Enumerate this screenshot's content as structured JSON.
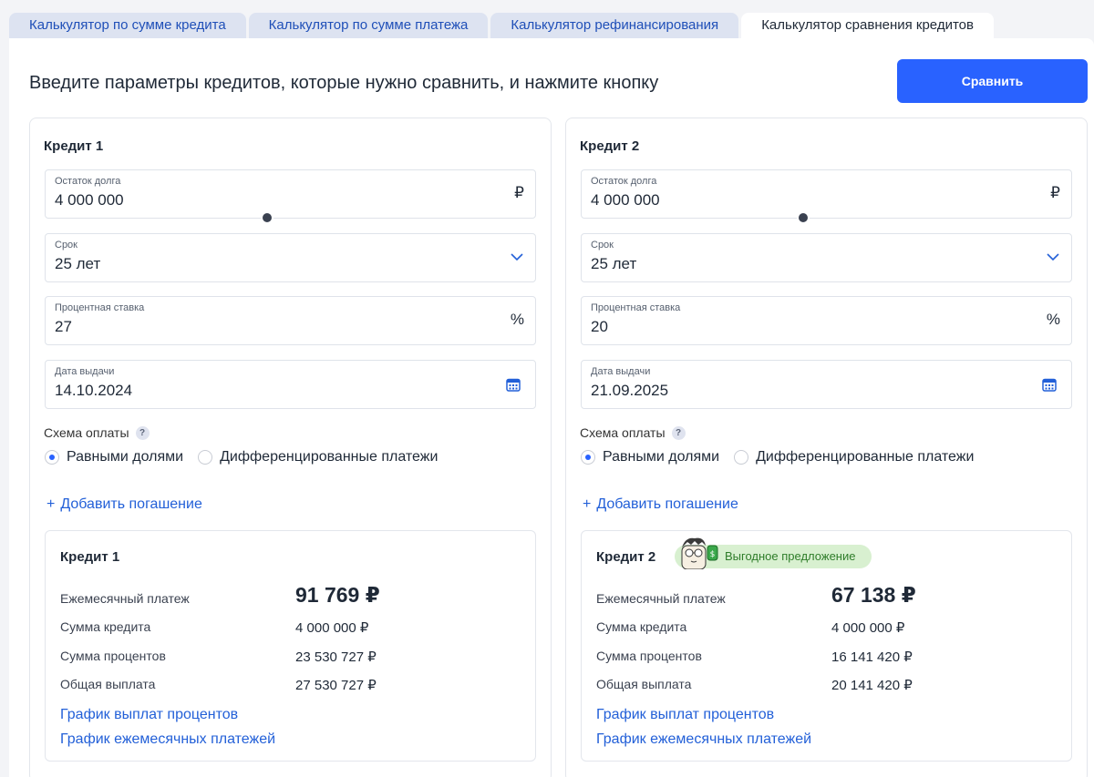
{
  "tabs": [
    {
      "label": "Калькулятор по сумме кредита"
    },
    {
      "label": "Калькулятор по сумме платежа"
    },
    {
      "label": "Калькулятор рефинансирования"
    },
    {
      "label": "Калькулятор сравнения кредитов"
    }
  ],
  "heading": "Введите параметры кредитов, которые нужно сравнить, и нажмите кнопку",
  "compare_button": "Сравнить",
  "credits": [
    {
      "title": "Кредит 1",
      "debt_label": "Остаток долга",
      "debt_value": "4 000 000",
      "debt_suffix": "₽",
      "term_label": "Срок",
      "term_value": "25 лет",
      "rate_label": "Процентная ставка",
      "rate_value": "27",
      "rate_suffix": "%",
      "date_label": "Дата выдачи",
      "date_value": "14.10.2024",
      "scheme_label": "Схема оплаты",
      "help": "?",
      "option_equal": "Равными долями",
      "option_diff": "Дифференцированные платежи",
      "add_repayment": "Добавить погашение",
      "plus": "+",
      "result": {
        "title": "Кредит 1",
        "monthly_label": "Ежемесячный платеж",
        "monthly_value": "91 769 ₽",
        "amount_label": "Сумма кредита",
        "amount_value": "4 000 000 ₽",
        "interest_label": "Сумма процентов",
        "interest_value": "23 530 727 ₽",
        "total_label": "Общая выплата",
        "total_value": "27 530 727 ₽",
        "link_interest": "График выплат процентов",
        "link_monthly": "График ежемесячных платежей"
      }
    },
    {
      "title": "Кредит 2",
      "debt_label": "Остаток долга",
      "debt_value": "4 000 000",
      "debt_suffix": "₽",
      "term_label": "Срок",
      "term_value": "25 лет",
      "rate_label": "Процентная ставка",
      "rate_value": "20",
      "rate_suffix": "%",
      "date_label": "Дата выдачи",
      "date_value": "21.09.2025",
      "scheme_label": "Схема оплаты",
      "help": "?",
      "option_equal": "Равными долями",
      "option_diff": "Дифференцированные платежи",
      "add_repayment": "Добавить погашение",
      "plus": "+",
      "result": {
        "title": "Кредит 2",
        "badge": "Выгодное предложение",
        "monthly_label": "Ежемесячный платеж",
        "monthly_value": "67 138 ₽",
        "amount_label": "Сумма кредита",
        "amount_value": "4 000 000 ₽",
        "interest_label": "Сумма процентов",
        "interest_value": "16 141 420 ₽",
        "total_label": "Общая выплата",
        "total_value": "20 141 420 ₽",
        "link_interest": "График выплат процентов",
        "link_monthly": "График ежемесячных платежей"
      }
    }
  ],
  "colors": {
    "accent": "#2962ff",
    "link": "#2360d8",
    "tab_bg": "#dde3f1",
    "badge_bg": "#d8f0d0",
    "badge_text": "#2f7d2a"
  },
  "icons": [
    "chevron-down-icon",
    "calendar-icon",
    "help-icon",
    "plus-icon",
    "mascot-icon"
  ]
}
